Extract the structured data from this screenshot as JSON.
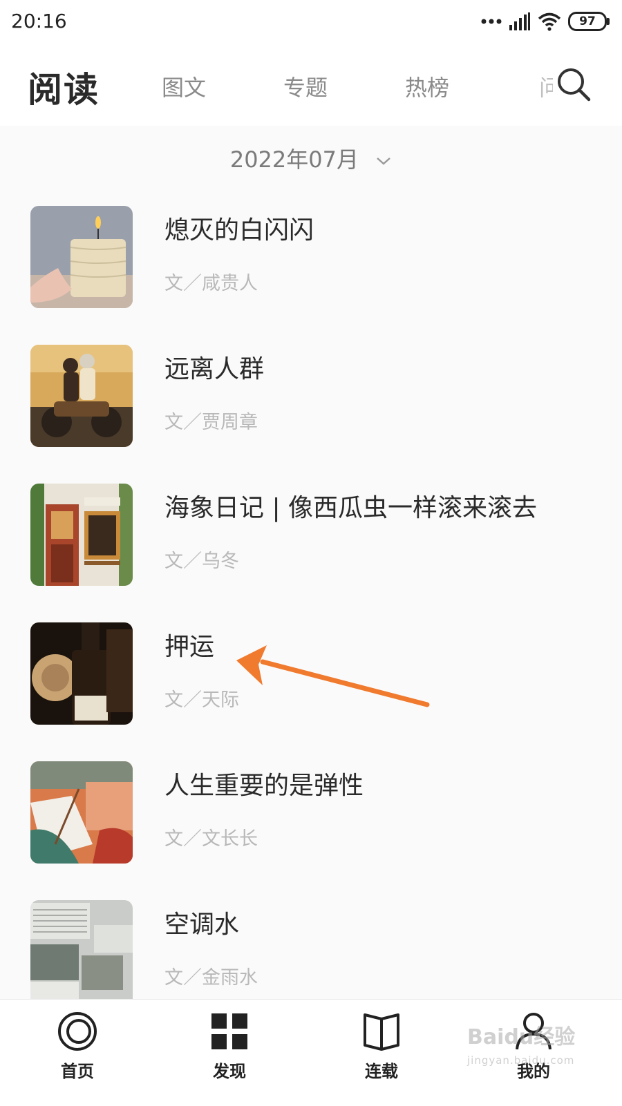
{
  "status_bar": {
    "time": "20:16",
    "battery": "97"
  },
  "header": {
    "title": "阅读",
    "tabs": [
      {
        "label": "图文"
      },
      {
        "label": "专题"
      },
      {
        "label": "热榜"
      },
      {
        "label": "问"
      }
    ]
  },
  "month_selector": {
    "value": "2022年07月"
  },
  "articles": [
    {
      "title": "熄灭的白闪闪",
      "author": "文／咸贵人",
      "thumb": "candle"
    },
    {
      "title": "远离人群",
      "author": "文／贾周章",
      "thumb": "motorbike"
    },
    {
      "title": "海象日记 | 像西瓜虫一样滚来滚去",
      "author": "文／乌冬",
      "thumb": "shopfront"
    },
    {
      "title": "押运",
      "author": "文／天际",
      "thumb": "bottle"
    },
    {
      "title": "人生重要的是弹性",
      "author": "文／文长长",
      "thumb": "painting"
    },
    {
      "title": "空调水",
      "author": "文／金雨水",
      "thumb": "aircon"
    }
  ],
  "bottom_nav": [
    {
      "label": "首页",
      "icon": "home-ring-icon"
    },
    {
      "label": "发现",
      "icon": "grid-icon"
    },
    {
      "label": "连载",
      "icon": "book-icon"
    },
    {
      "label": "我的",
      "icon": "person-icon"
    }
  ],
  "watermark": {
    "text": "Baidu经验",
    "sub": "jingyan.baidu.com"
  },
  "colors": {
    "accent_arrow": "#f07a2e",
    "text_primary": "#2a2a2a",
    "text_secondary": "#b8b8b8"
  }
}
